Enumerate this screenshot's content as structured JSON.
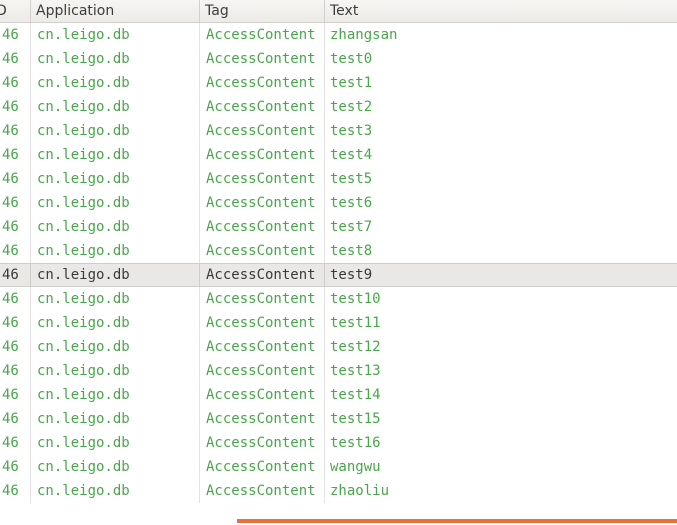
{
  "columns": {
    "pid": "D",
    "application": "Application",
    "tag": "Tag",
    "text": "Text"
  },
  "rows": [
    {
      "pid": "46",
      "application": "cn.leigo.db",
      "tag": "AccessContent",
      "text": "zhangsan"
    },
    {
      "pid": "46",
      "application": "cn.leigo.db",
      "tag": "AccessContent",
      "text": "test0"
    },
    {
      "pid": "46",
      "application": "cn.leigo.db",
      "tag": "AccessContent",
      "text": "test1"
    },
    {
      "pid": "46",
      "application": "cn.leigo.db",
      "tag": "AccessContent",
      "text": "test2"
    },
    {
      "pid": "46",
      "application": "cn.leigo.db",
      "tag": "AccessContent",
      "text": "test3"
    },
    {
      "pid": "46",
      "application": "cn.leigo.db",
      "tag": "AccessContent",
      "text": "test4"
    },
    {
      "pid": "46",
      "application": "cn.leigo.db",
      "tag": "AccessContent",
      "text": "test5"
    },
    {
      "pid": "46",
      "application": "cn.leigo.db",
      "tag": "AccessContent",
      "text": "test6"
    },
    {
      "pid": "46",
      "application": "cn.leigo.db",
      "tag": "AccessContent",
      "text": "test7"
    },
    {
      "pid": "46",
      "application": "cn.leigo.db",
      "tag": "AccessContent",
      "text": "test8"
    },
    {
      "pid": "46",
      "application": "cn.leigo.db",
      "tag": "AccessContent",
      "text": "test9"
    },
    {
      "pid": "46",
      "application": "cn.leigo.db",
      "tag": "AccessContent",
      "text": "test10"
    },
    {
      "pid": "46",
      "application": "cn.leigo.db",
      "tag": "AccessContent",
      "text": "test11"
    },
    {
      "pid": "46",
      "application": "cn.leigo.db",
      "tag": "AccessContent",
      "text": "test12"
    },
    {
      "pid": "46",
      "application": "cn.leigo.db",
      "tag": "AccessContent",
      "text": "test13"
    },
    {
      "pid": "46",
      "application": "cn.leigo.db",
      "tag": "AccessContent",
      "text": "test14"
    },
    {
      "pid": "46",
      "application": "cn.leigo.db",
      "tag": "AccessContent",
      "text": "test15"
    },
    {
      "pid": "46",
      "application": "cn.leigo.db",
      "tag": "AccessContent",
      "text": "test16"
    },
    {
      "pid": "46",
      "application": "cn.leigo.db",
      "tag": "AccessContent",
      "text": "wangwu"
    },
    {
      "pid": "46",
      "application": "cn.leigo.db",
      "tag": "AccessContent",
      "text": "zhaoliu"
    }
  ],
  "selected_row_index": 10,
  "colors": {
    "log_text": "#4aa64a",
    "selected_bg": "#e9e8e6",
    "accent": "#e8703a"
  }
}
